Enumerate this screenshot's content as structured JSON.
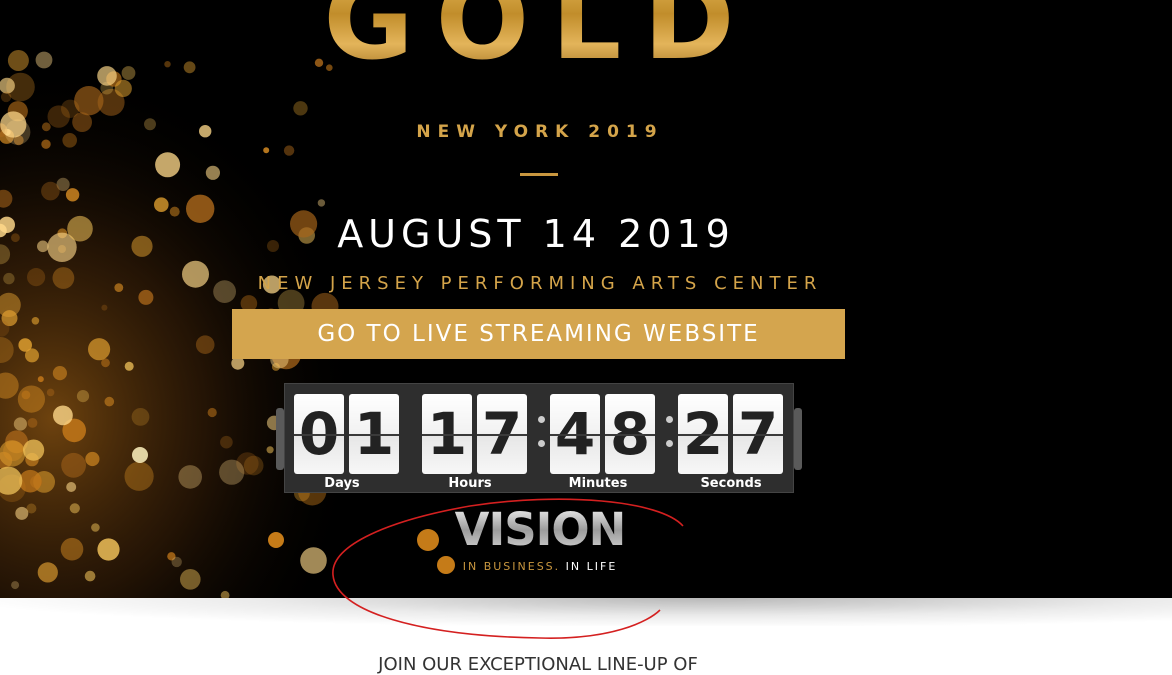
{
  "hero": {
    "title": "GOLD",
    "subtitle": "NEW YORK 2019",
    "date": "AUGUST 14 2019",
    "venue": "NEW JERSEY PERFORMING ARTS CENTER",
    "stream_button_label": "GO TO LIVE STREAMING WEBSITE"
  },
  "countdown": {
    "days": [
      "0",
      "1"
    ],
    "hours": [
      "1",
      "7"
    ],
    "minutes": [
      "4",
      "8"
    ],
    "seconds": [
      "2",
      "7"
    ],
    "labels": {
      "days": "Days",
      "hours": "Hours",
      "minutes": "Minutes",
      "seconds": "Seconds"
    }
  },
  "sponsor": {
    "logo_text": "VISION",
    "tagline_gold": "IN BUSINESS.",
    "tagline_white": "IN LIFE"
  },
  "section": {
    "intro": "JOIN OUR EXCEPTIONAL LINE-UP OF"
  },
  "colors": {
    "gold": "#d4a44a",
    "button": "#d4a54e",
    "background": "#000000",
    "annotation": "#d42020"
  }
}
